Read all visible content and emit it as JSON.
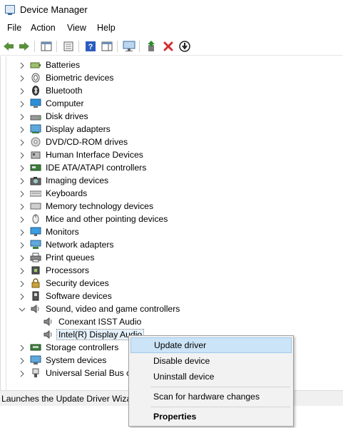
{
  "window": {
    "title": "Device Manager",
    "icon": "device-manager-icon"
  },
  "menu": [
    "File",
    "Action",
    "View",
    "Help"
  ],
  "toolbar": {
    "buttons": [
      "back-arrow-icon",
      "forward-arrow-icon",
      "show-hide-console-tree-icon",
      "properties-icon",
      "help-icon",
      "action-pane-icon",
      "monitor-icon",
      "update-driver-icon",
      "uninstall-x-icon",
      "disable-device-icon"
    ],
    "colors": {
      "uninstall": "#d32f2f",
      "help": "#2b5cbf",
      "update": "#2e8b2e"
    }
  },
  "tree": {
    "items": [
      {
        "label": "Batteries",
        "icon": "battery-icon",
        "expanded": false
      },
      {
        "label": "Biometric devices",
        "icon": "fingerprint-icon",
        "expanded": false
      },
      {
        "label": "Bluetooth",
        "icon": "bluetooth-icon",
        "expanded": false
      },
      {
        "label": "Computer",
        "icon": "computer-icon",
        "expanded": false
      },
      {
        "label": "Disk drives",
        "icon": "disk-drive-icon",
        "expanded": false
      },
      {
        "label": "Display adapters",
        "icon": "display-adapter-icon",
        "expanded": false
      },
      {
        "label": "DVD/CD-ROM drives",
        "icon": "dvd-drive-icon",
        "expanded": false
      },
      {
        "label": "Human Interface Devices",
        "icon": "hid-icon",
        "expanded": false
      },
      {
        "label": "IDE ATA/ATAPI controllers",
        "icon": "ide-controller-icon",
        "expanded": false
      },
      {
        "label": "Imaging devices",
        "icon": "camera-icon",
        "expanded": false
      },
      {
        "label": "Keyboards",
        "icon": "keyboard-icon",
        "expanded": false
      },
      {
        "label": "Memory technology devices",
        "icon": "memory-icon",
        "expanded": false
      },
      {
        "label": "Mice and other pointing devices",
        "icon": "mouse-icon",
        "expanded": false
      },
      {
        "label": "Monitors",
        "icon": "monitor-icon",
        "expanded": false
      },
      {
        "label": "Network adapters",
        "icon": "network-icon",
        "expanded": false
      },
      {
        "label": "Print queues",
        "icon": "printer-icon",
        "expanded": false
      },
      {
        "label": "Processors",
        "icon": "processor-icon",
        "expanded": false
      },
      {
        "label": "Security devices",
        "icon": "security-icon",
        "expanded": false
      },
      {
        "label": "Software devices",
        "icon": "software-device-icon",
        "expanded": false
      },
      {
        "label": "Sound, video and game controllers",
        "icon": "speaker-icon",
        "expanded": true,
        "children": [
          "Conexant ISST Audio",
          "Intel(R) Display Audio"
        ]
      },
      {
        "label": "Storage controllers",
        "icon": "storage-icon",
        "expanded": false
      },
      {
        "label": "System devices",
        "icon": "system-device-icon",
        "expanded": false
      },
      {
        "label": "Universal Serial Bus co",
        "icon": "usb-icon",
        "expanded": false
      }
    ],
    "selected_child": "Intel(R) Display Audio"
  },
  "context_menu": {
    "items": [
      "Update driver",
      "Disable device",
      "Uninstall device",
      "Scan for hardware changes",
      "Properties"
    ],
    "highlighted": "Update driver",
    "default": "Properties"
  },
  "status": {
    "text": "Launches the Update Driver Wizar"
  }
}
